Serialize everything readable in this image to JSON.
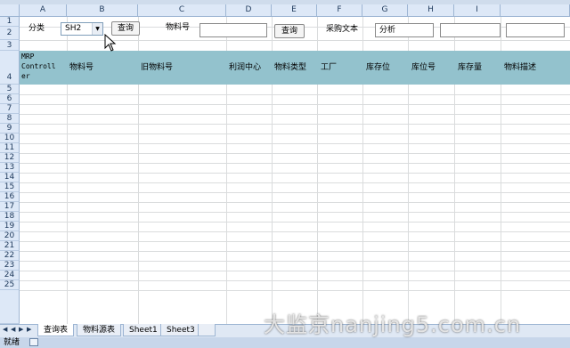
{
  "columns": [
    "A",
    "B",
    "C",
    "D",
    "E",
    "F",
    "G",
    "H",
    "I"
  ],
  "rows": [
    "1",
    "2",
    "3",
    "4",
    "5",
    "6",
    "7",
    "8",
    "9",
    "10",
    "11",
    "12",
    "13",
    "14",
    "15",
    "16",
    "17",
    "18",
    "19",
    "20",
    "21",
    "22",
    "23",
    "24",
    "25"
  ],
  "controls": {
    "category_label": "分类",
    "category_value": "SH2",
    "query_button_1": "查询",
    "material_no_label": "物料号",
    "material_no_value": "",
    "query_button_2": "查询",
    "purchase_text_label": "采购文本",
    "analyze_box": "分析",
    "extra_box_1": "",
    "extra_box_2": ""
  },
  "table_headers": {
    "mrp_line1": "MRP",
    "mrp_line2": "Controll",
    "mrp_line3": "er",
    "material_no": "物料号",
    "old_material_no": "旧物料号",
    "profit_center": "利润中心",
    "material_type": "物料类型",
    "plant": "工厂",
    "storage_location": "库存位",
    "bin": "库位号",
    "stock_qty": "库存量",
    "material_desc": "物料描述"
  },
  "sheet_tabs": [
    "查询表",
    "物料源表",
    "Sheet1",
    "Sheet3"
  ],
  "status": "就绪",
  "watermark": "大监京nanjing5.com.cn",
  "colors": {
    "header_fill": "#93c2cd",
    "grid_header": "#dde8f7"
  }
}
